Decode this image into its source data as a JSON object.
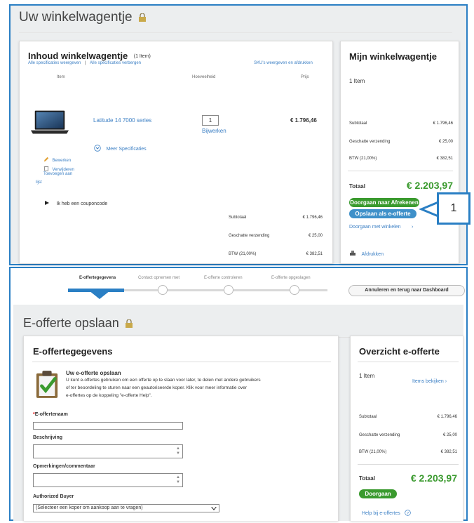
{
  "cart": {
    "page_title": "Uw winkelwagentje",
    "contents_title": "Inhoud winkelwagentje",
    "item_count": "(1 Item)",
    "show_specs": "Alle specificaties weergeven",
    "separator": "|",
    "hide_specs": "Alle specificaties verbergen",
    "show_skus": "SKU's weergeven en afdrukken",
    "col_item": "Item",
    "col_qty": "Hoeveelheid",
    "col_price": "Prijs",
    "product_name": "Latitude 14 7000 series",
    "qty": "1",
    "update_label": "Bijwerken",
    "price": "€ 1.796,46",
    "more_specs": "Meer Specificaties",
    "edit": "Bewerken",
    "remove": "Verwijderen",
    "add_to_list_1": "Toevoegen aan",
    "add_to_list_2": "lijst",
    "coupon": "Ik heb een couponcode",
    "subtotal_label": "Subtotaal",
    "subtotal_value": "€ 1.796,46",
    "shipping_label": "Geschatte verzending",
    "shipping_value": "€ 25,00",
    "vat_label": "BTW (21,00%)",
    "vat_value": "€ 382,51"
  },
  "my_cart": {
    "title": "Mijn winkelwagentje",
    "item_count": "1 Item",
    "subtotal_label": "Subtotaal",
    "subtotal_value": "€ 1.796,46",
    "shipping_label": "Geschatte verzending",
    "shipping_value": "€ 25,00",
    "vat_label": "BTW (21,00%)",
    "vat_value": "€ 382,51",
    "total_label": "Totaal",
    "total_value": "€ 2.203,97",
    "checkout_button": "Doorgaan naar Afrekenen",
    "save_quote_button": "Opslaan als e-offerte",
    "continue_shopping": "Doorgaan met winkelen",
    "print": "Afdrukken"
  },
  "callout": {
    "number": "1"
  },
  "progress": {
    "steps": [
      "E-offertegegevens",
      "Contact opnemen met",
      "E-offerte controleren",
      "E-offerte opgeslagen"
    ],
    "cancel_button": "Annuleren en terug naar Dashboard"
  },
  "quote": {
    "page_title": "E-offerte opslaan",
    "section_title": "E-offertegegevens",
    "save_title": "Uw e-offerte opslaan",
    "save_text_1": "U kunt e-offertes gebruiken om een offerte op te slaan voor later, te delen met andere gebruikers",
    "save_text_2": "of ter beoordeling te sturen naar een geautoriseerde koper. Klik voor meer informatie over",
    "save_text_3": "e-offertes op de koppeling \"e-offerte Help\".",
    "name_required": "*",
    "name_label": "E-offertenaam",
    "name_value": "",
    "description_label": "Beschrijving",
    "description_value": "",
    "comments_label": "Opmerkingen/commentaar",
    "comments_value": "",
    "buyer_label": "Authorized Buyer",
    "buyer_selected": "(Selecteer een koper om aankoop aan te vragen)"
  },
  "overview": {
    "title": "Overzicht e-offerte",
    "item_count": "1 Item",
    "view_items": "Items bekijken",
    "subtotal_label": "Subtotaal",
    "subtotal_value": "€ 1.796,46",
    "shipping_label": "Geschatte verzending",
    "shipping_value": "€ 25,00",
    "vat_label": "BTW (21,00%)",
    "vat_value": "€ 382,51",
    "total_label": "Totaal",
    "total_value": "€ 2.203,97",
    "continue_button": "Doorgaan",
    "help_link": "Help bij e-offertes"
  },
  "colors": {
    "frame_blue": "#2a7fc4",
    "link_blue": "#3b7fc4",
    "total_green": "#3a9a2e",
    "progress_blue": "#2a7fc4"
  },
  "icons": [
    "lock-icon",
    "laptop-image",
    "pencil-icon",
    "trash-icon",
    "chevron-down-circle-icon",
    "triangle-right-icon",
    "printer-icon",
    "clipboard-check-icon",
    "help-circle-icon"
  ]
}
